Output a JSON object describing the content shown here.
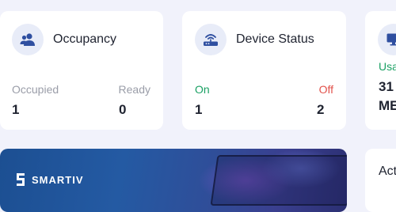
{
  "occupancy": {
    "title": "Occupancy",
    "left_label": "Occupied",
    "left_value": "1",
    "right_label": "Ready",
    "right_value": "0",
    "icon": "users-icon"
  },
  "device_status": {
    "title": "Device Status",
    "left_label": "On",
    "left_value": "1",
    "right_label": "Off",
    "right_value": "2",
    "icon": "router-icon"
  },
  "usage": {
    "label": "Usa",
    "value": "31",
    "unit": "ME",
    "icon": "monitor-icon"
  },
  "activity": {
    "title": "Act"
  },
  "banner": {
    "brand": "SMARTIV"
  },
  "colors": {
    "accent": "#2f4fa0",
    "on": "#1aa063",
    "off": "#e2524b",
    "muted": "#9a9da8"
  }
}
